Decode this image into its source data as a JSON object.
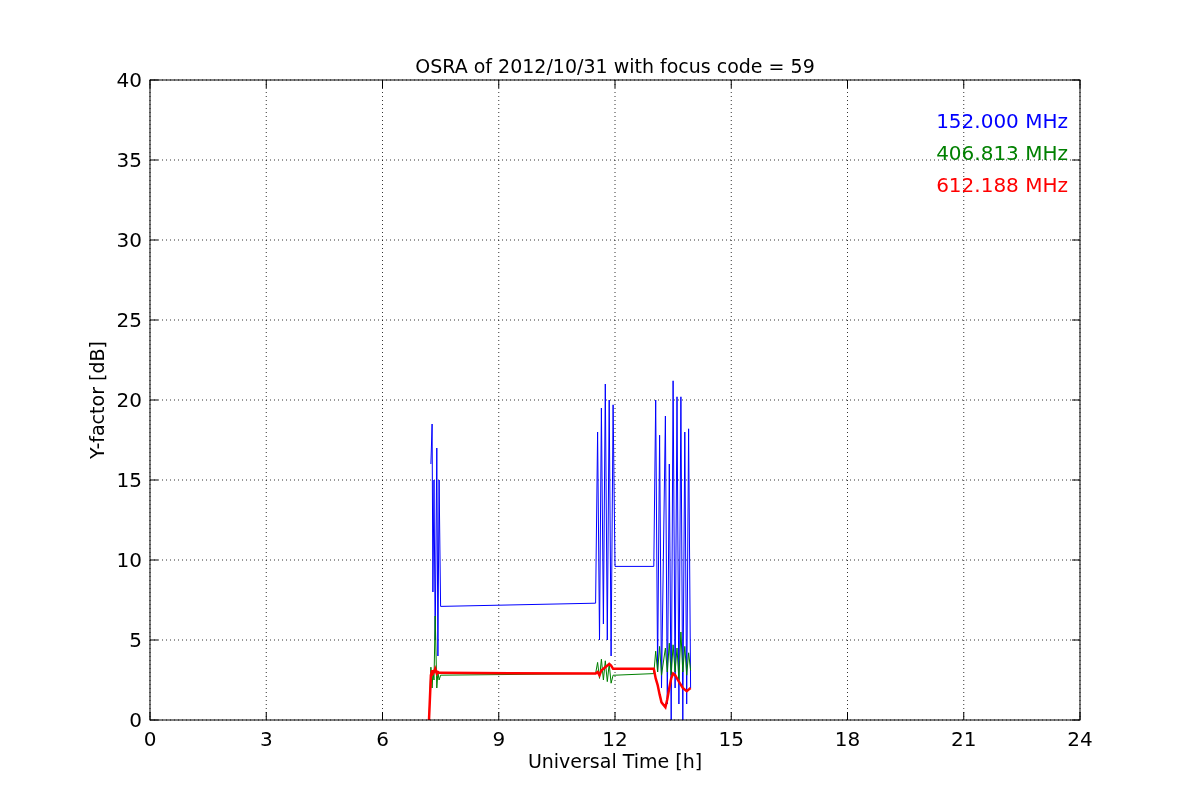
{
  "plot": {
    "chart_data": {
      "type": "line",
      "title": "OSRA of 2012/10/31 with focus code = 59",
      "xlabel": "Universal Time [h]",
      "ylabel": "Y-factor [dB]",
      "grid": true,
      "xlim": [
        0,
        24
      ],
      "ylim": [
        0,
        40
      ],
      "xticks": [
        0,
        3,
        6,
        9,
        12,
        15,
        18,
        21,
        24
      ],
      "yticks": [
        0,
        5,
        10,
        15,
        20,
        25,
        30,
        35,
        40
      ],
      "x": [
        7.2,
        7.25,
        7.28,
        7.3,
        7.33,
        7.36,
        7.4,
        7.43,
        7.46,
        7.5,
        11.5,
        11.55,
        11.6,
        11.65,
        11.7,
        11.75,
        11.8,
        11.85,
        11.9,
        11.95,
        12.0,
        13.0,
        13.05,
        13.1,
        13.15,
        13.2,
        13.3,
        13.35,
        13.4,
        13.45,
        13.5,
        13.55,
        13.6,
        13.65,
        13.7,
        13.75,
        13.8,
        13.85,
        13.9,
        13.95
      ],
      "series": [
        {
          "name": "152.000 MHz",
          "color": "#0000ff",
          "values": [
            null,
            16,
            18.5,
            8,
            15,
            5,
            17,
            4,
            15,
            7.1,
            7.3,
            18,
            5,
            19.5,
            6,
            21,
            5,
            20,
            4,
            19.7,
            9.6,
            9.6,
            20,
            3,
            17.8,
            2,
            19,
            1,
            16,
            0,
            21.2,
            2,
            20.2,
            1,
            20.2,
            0,
            18,
            1,
            18.2,
            2
          ]
        },
        {
          "name": "406.813 MHz",
          "color": "#008000",
          "values": [
            0,
            3.3,
            2,
            3,
            2.5,
            6.5,
            2,
            3,
            2.5,
            2.8,
            2.9,
            3.6,
            2.6,
            3.8,
            2.5,
            3.7,
            2.4,
            3.5,
            2.3,
            2.8,
            2.8,
            2.9,
            4.3,
            3,
            4.6,
            2.8,
            4.5,
            3,
            4.8,
            2.8,
            4.7,
            3,
            4.5,
            2.5,
            5.5,
            3,
            4.6,
            2.8,
            4.2,
            3.1
          ]
        },
        {
          "name": "612.188 MHz",
          "color": "#ff0000",
          "values": [
            0,
            2.8,
            3.1,
            2.9,
            3,
            3.2,
            2.9,
            3,
            2.95,
            2.95,
            2.9,
            3.0,
            2.8,
            3.1,
            3.2,
            3.3,
            3.4,
            3.5,
            3.4,
            3.2,
            3.2,
            3.2,
            2.6,
            2.2,
            1.6,
            1.1,
            0.8,
            1.3,
            2.0,
            2.6,
            2.9,
            2.8,
            2.6,
            2.4,
            2.2,
            2.0,
            1.9,
            1.8,
            1.9,
            2.0
          ]
        }
      ]
    }
  }
}
